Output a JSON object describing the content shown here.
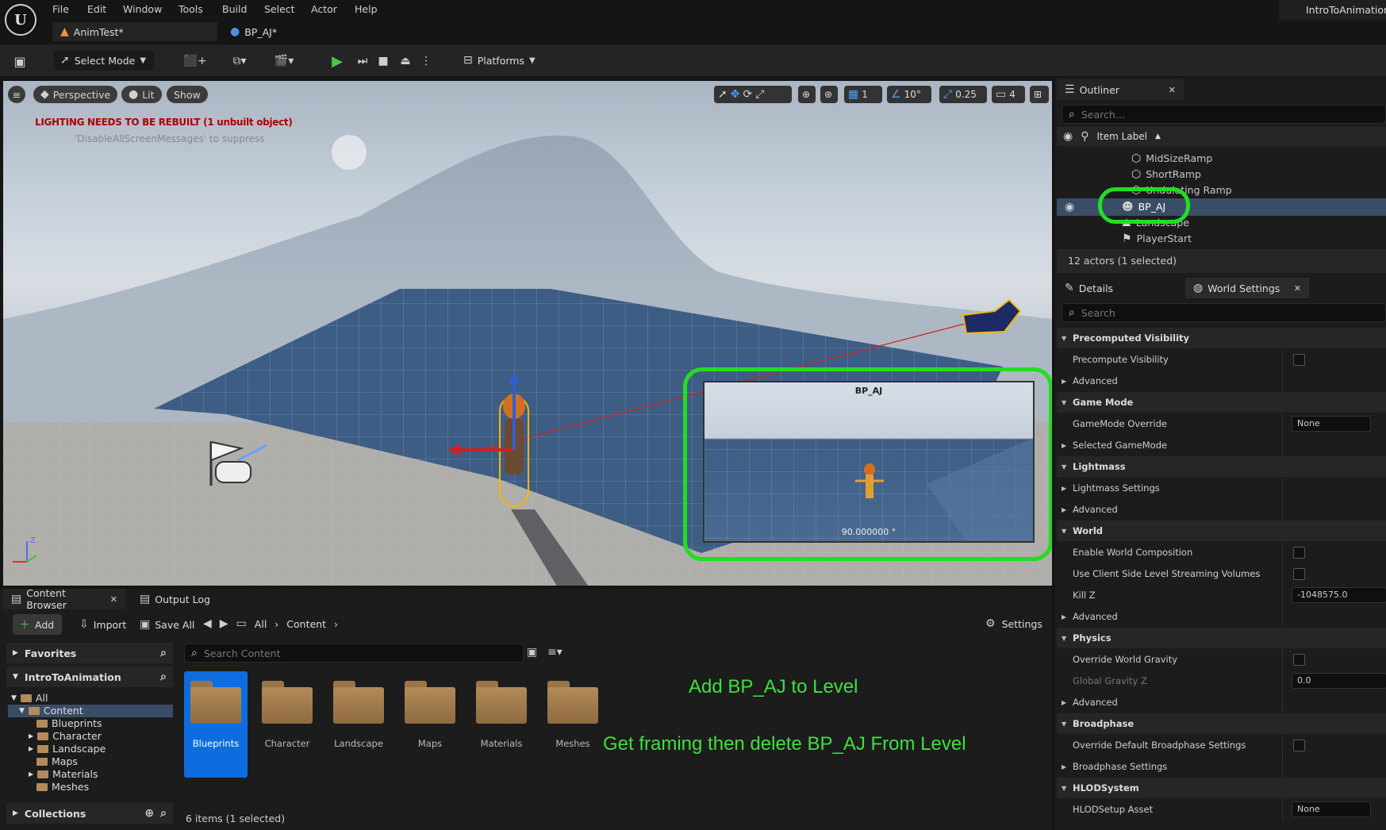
{
  "app": {
    "logo_text": "U",
    "project": "IntroToAnimation"
  },
  "menu": [
    "File",
    "Edit",
    "Window",
    "Tools",
    "Build",
    "Select",
    "Actor",
    "Help"
  ],
  "doc_tabs": [
    {
      "label": "AnimTest*"
    },
    {
      "label": "BP_AJ*"
    }
  ],
  "toolbar": {
    "mode_label": "Select Mode",
    "platforms_label": "Platforms"
  },
  "viewport": {
    "perspective": "Perspective",
    "lit": "Lit",
    "show": "Show",
    "warning": "LIGHTING NEEDS TO BE REBUILT (1 unbuilt object)",
    "suppress": "'DisableAllScreenMessages' to suppress",
    "grid_size": "1",
    "rot_snap": "10°",
    "scale_snap": "0.25",
    "cam_speed": "4",
    "preview_title": "BP_AJ",
    "preview_fov": "90.000000 °",
    "axis_z": "Z"
  },
  "outliner": {
    "title": "Outliner",
    "search": "Search...",
    "column": "Item Label",
    "items": [
      {
        "label": "MidSizeRamp"
      },
      {
        "label": "ShortRamp"
      },
      {
        "label": "Undulating Ramp"
      },
      {
        "label": "BP_AJ"
      },
      {
        "label": "Landscape"
      },
      {
        "label": "PlayerStart"
      }
    ],
    "status": "12 actors (1 selected)"
  },
  "details": {
    "tab_details": "Details",
    "tab_world": "World Settings",
    "search": "Search",
    "rows": [
      {
        "kind": "cat",
        "label": "Precomputed Visibility"
      },
      {
        "kind": "cb",
        "label": "Precompute Visibility"
      },
      {
        "kind": "sub",
        "label": "Advanced"
      },
      {
        "kind": "cat",
        "label": "Game Mode"
      },
      {
        "kind": "drop",
        "label": "GameMode Override",
        "value": "None"
      },
      {
        "kind": "sub",
        "label": "Selected GameMode"
      },
      {
        "kind": "cat",
        "label": "Lightmass"
      },
      {
        "kind": "sub",
        "label": "Lightmass Settings"
      },
      {
        "kind": "sub",
        "label": "Advanced"
      },
      {
        "kind": "cat",
        "label": "World"
      },
      {
        "kind": "cb",
        "label": "Enable World Composition"
      },
      {
        "kind": "cb",
        "label": "Use Client Side Level Streaming Volumes"
      },
      {
        "kind": "text",
        "label": "Kill Z",
        "value": "-1048575.0"
      },
      {
        "kind": "sub",
        "label": "Advanced"
      },
      {
        "kind": "cat",
        "label": "Physics"
      },
      {
        "kind": "cb",
        "label": "Override World Gravity"
      },
      {
        "kind": "text",
        "label": "Global Gravity Z",
        "value": "0.0"
      },
      {
        "kind": "sub",
        "label": "Advanced"
      },
      {
        "kind": "cat",
        "label": "Broadphase"
      },
      {
        "kind": "cb",
        "label": "Override Default Broadphase Settings"
      },
      {
        "kind": "sub",
        "label": "Broadphase Settings"
      },
      {
        "kind": "cat",
        "label": "HLODSystem"
      },
      {
        "kind": "drop",
        "label": "HLODSetup Asset",
        "value": "None"
      }
    ]
  },
  "content_browser": {
    "tab": "Content Browser",
    "output_tab": "Output Log",
    "add": "Add",
    "import": "Import",
    "save_all": "Save All",
    "path_all": "All",
    "path_content": "Content",
    "settings": "Settings",
    "favorites": "Favorites",
    "project": "IntroToAnimation",
    "collections": "Collections",
    "search": "Search Content",
    "tree": [
      {
        "label": "All"
      },
      {
        "label": "Content"
      },
      {
        "label": "Blueprints"
      },
      {
        "label": "Character"
      },
      {
        "label": "Landscape"
      },
      {
        "label": "Maps"
      },
      {
        "label": "Materials"
      },
      {
        "label": "Meshes"
      }
    ],
    "folders": [
      {
        "label": "Blueprints"
      },
      {
        "label": "Character"
      },
      {
        "label": "Landscape"
      },
      {
        "label": "Maps"
      },
      {
        "label": "Materials"
      },
      {
        "label": "Meshes"
      }
    ],
    "status": "6 items (1 selected)"
  },
  "annotations": {
    "line1": "Add BP_AJ to Level",
    "line2": "Get framing then delete BP_AJ From Level"
  }
}
